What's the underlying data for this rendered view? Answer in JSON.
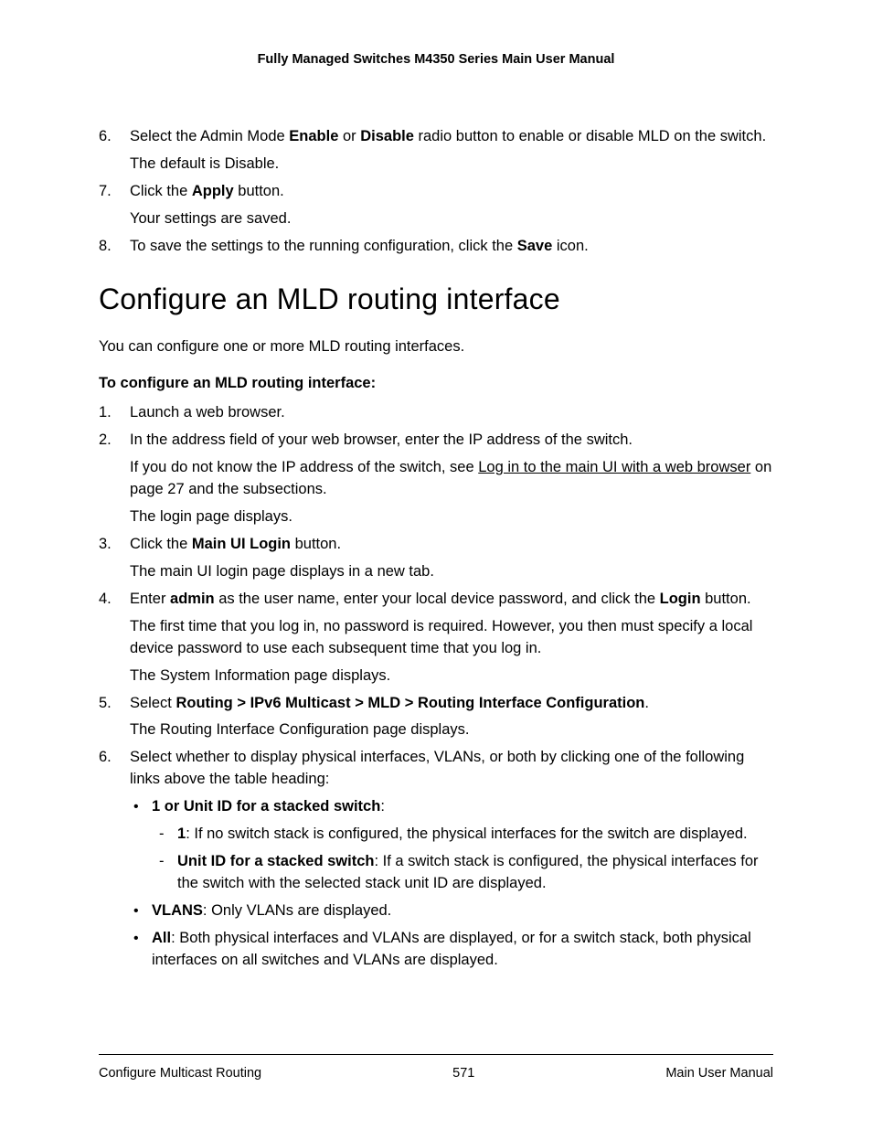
{
  "header": "Fully Managed Switches M4350 Series Main User Manual",
  "top_list": {
    "item6": {
      "num": "6.",
      "pre": "Select the Admin Mode ",
      "bold_enable": "Enable",
      "mid": " or ",
      "bold_disable": "Disable",
      "post": " radio button to enable or disable MLD on the switch.",
      "p2": "The default is Disable."
    },
    "item7": {
      "num": "7.",
      "pre": "Click the ",
      "bold": "Apply",
      "post": " button.",
      "p2": "Your settings are saved."
    },
    "item8": {
      "num": "8.",
      "pre": "To save the settings to the running configuration, click the ",
      "bold": "Save",
      "post": " icon."
    }
  },
  "heading": "Configure an MLD routing interface",
  "intro": "You can configure one or more MLD routing interfaces.",
  "subhead": "To configure an MLD routing interface:",
  "steps": {
    "s1": {
      "num": "1.",
      "text": "Launch a web browser."
    },
    "s2": {
      "num": "2.",
      "p1": "In the address field of your web browser, enter the IP address of the switch.",
      "p2_pre": "If you do not know the IP address of the switch, see ",
      "p2_link": "Log in to the main UI with a web browser",
      "p2_post": " on page 27 and the subsections.",
      "p3": "The login page displays."
    },
    "s3": {
      "num": "3.",
      "pre": "Click the ",
      "bold": "Main UI Login",
      "post": " button.",
      "p2": "The main UI login page displays in a new tab."
    },
    "s4": {
      "num": "4.",
      "pre": "Enter ",
      "bold_admin": "admin",
      "mid": " as the user name, enter your local device password, and click the ",
      "bold_login": "Login",
      "post": " button.",
      "p2": "The first time that you log in, no password is required. However, you then must specify a local device password to use each subsequent time that you log in.",
      "p3": "The System Information page displays."
    },
    "s5": {
      "num": "5.",
      "pre": "Select ",
      "bold": "Routing > IPv6 Multicast > MLD > Routing Interface Configuration",
      "post": ".",
      "p2": "The Routing Interface Configuration page displays."
    },
    "s6": {
      "num": "6.",
      "p1": "Select whether to display physical interfaces, VLANs, or both by clicking one of the following links above the table heading:",
      "b1": {
        "bold": "1 or Unit ID for a stacked switch",
        "post": ":",
        "d1": {
          "bold": "1",
          "post": ": If no switch stack is configured, the physical interfaces for the switch are displayed."
        },
        "d2": {
          "bold": "Unit ID for a stacked switch",
          "post": ": If a switch stack is configured, the physical interfaces for the switch with the selected stack unit ID are displayed."
        }
      },
      "b2": {
        "bold": "VLANS",
        "post": ": Only VLANs are displayed."
      },
      "b3": {
        "bold": "All",
        "post": ": Both physical interfaces and VLANs are displayed, or for a switch stack, both physical interfaces on all switches and VLANs are displayed."
      }
    }
  },
  "footer": {
    "left": "Configure Multicast Routing",
    "center": "571",
    "right": "Main User Manual"
  }
}
